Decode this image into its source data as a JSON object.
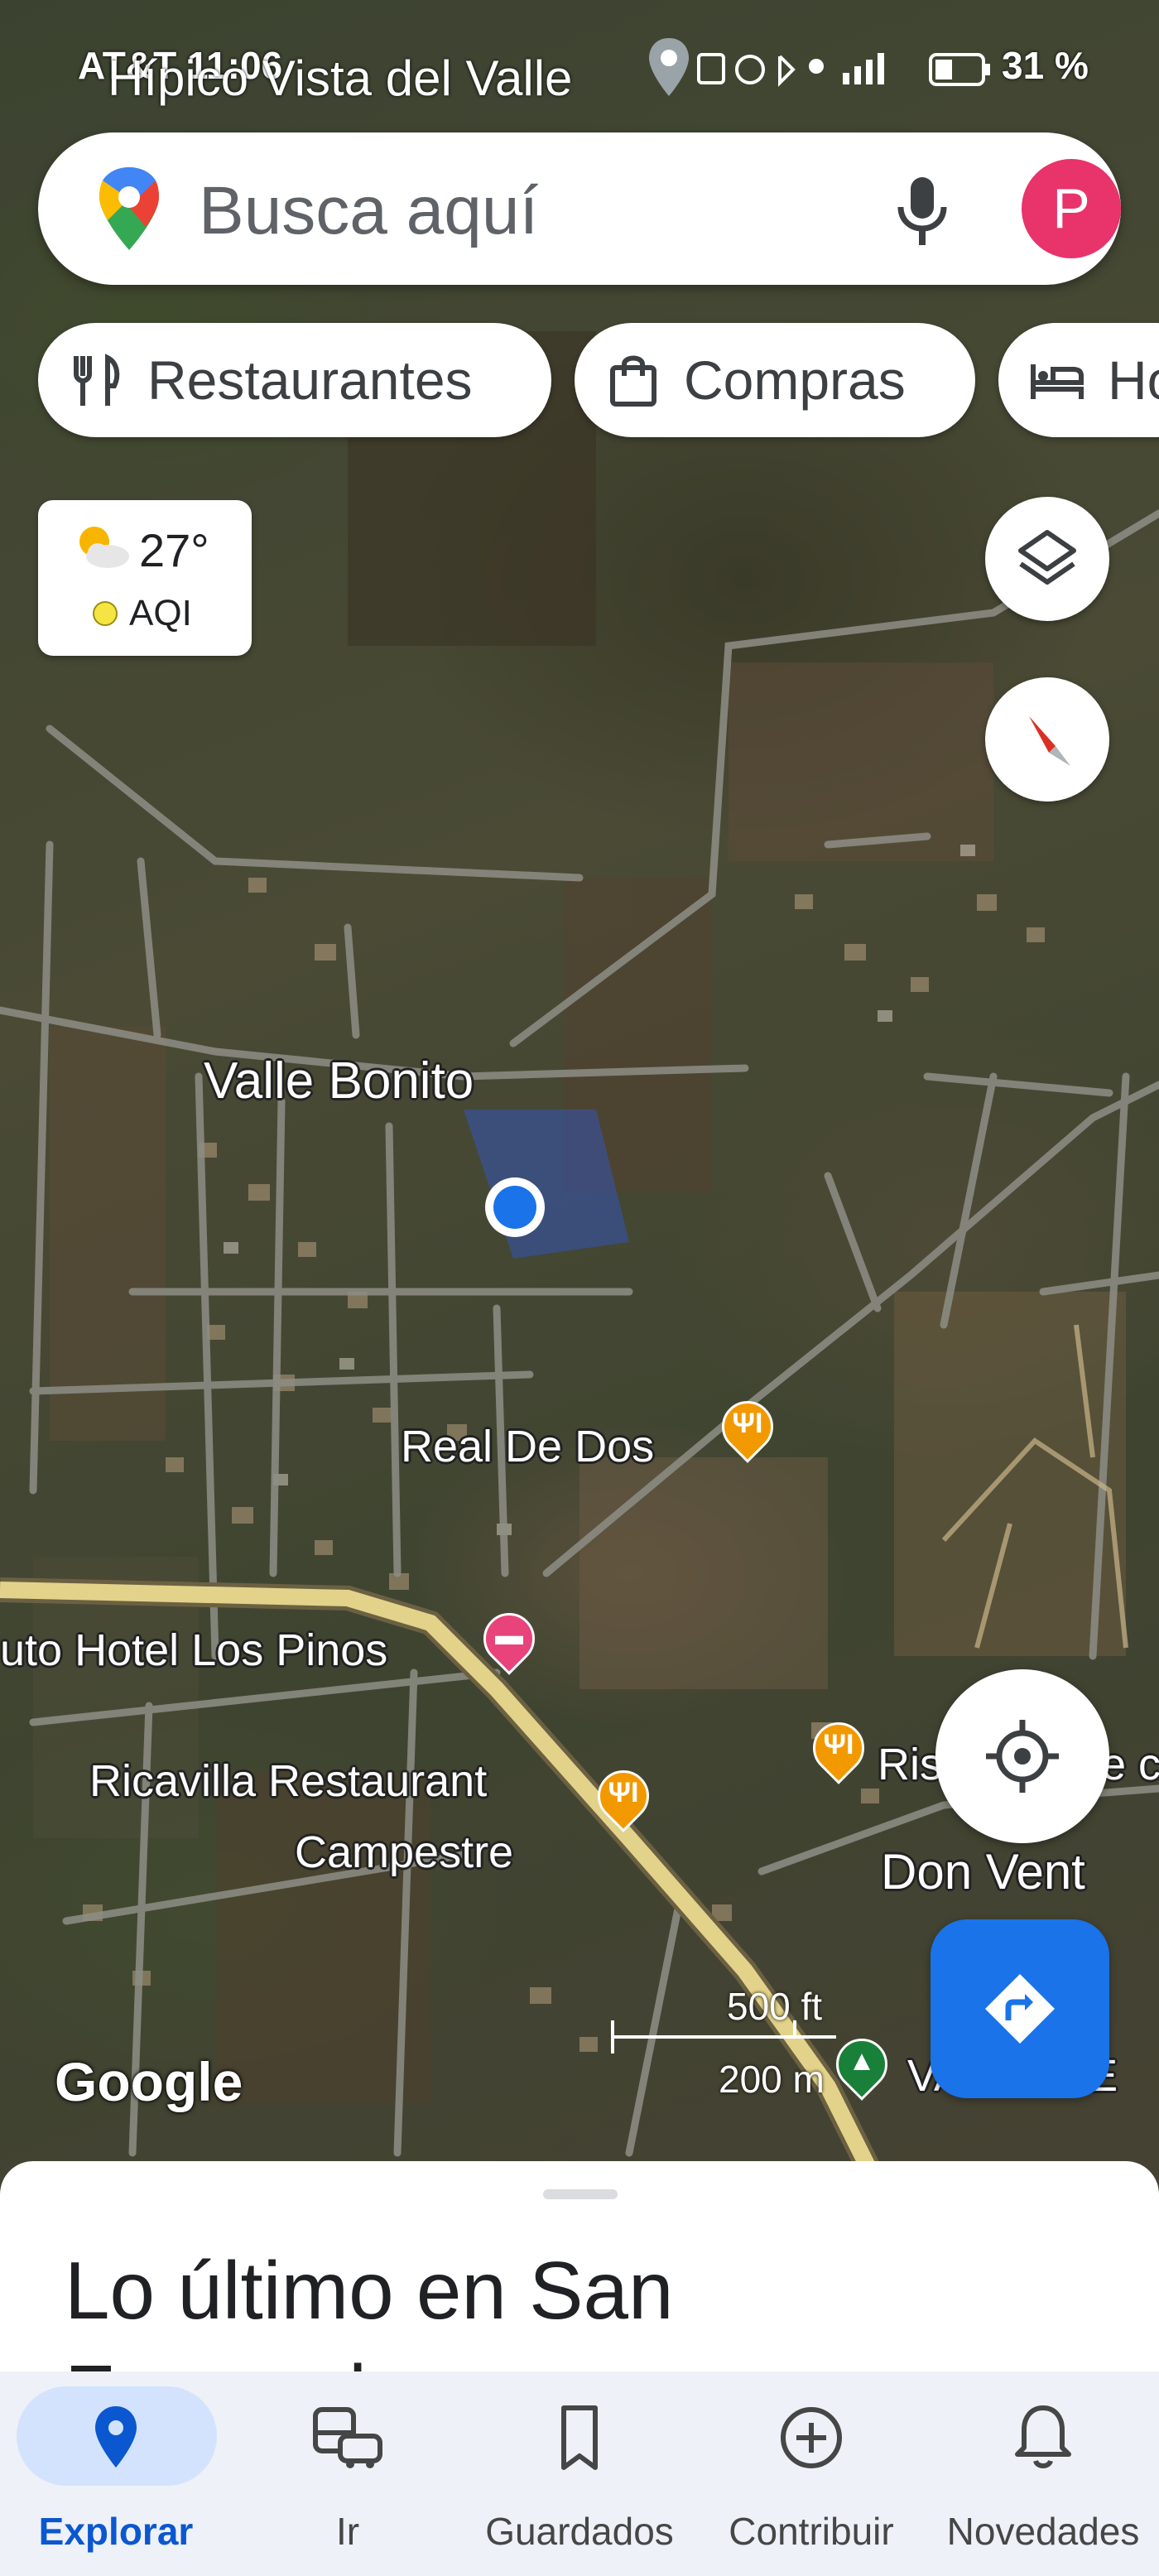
{
  "status_bar": {
    "left_text": "AT&T 11:06",
    "overlay_place": "Hípico Vista del Valle",
    "battery": "31 %"
  },
  "search": {
    "placeholder": "Busca aquí",
    "avatar_initial": "P"
  },
  "chips": [
    {
      "label": "Restaurantes",
      "icon": "fork-knife-icon"
    },
    {
      "label": "Compras",
      "icon": "shopping-bag-icon"
    },
    {
      "label": "Ho",
      "icon": "bed-icon"
    }
  ],
  "weather": {
    "temperature": "27°",
    "aqi_label": "AQI"
  },
  "map": {
    "labels": {
      "valle_bonito": "Valle Bonito",
      "real_de_dos": "Real De Dos",
      "hotel_los_pinos": "uto Hotel Los Pinos",
      "ricavilla_line1": "Ricavilla Restaurant",
      "ricavilla_line2": "Campestre",
      "ris": "Ris",
      "ris_tail": "e c",
      "don_vent": "Don Vent",
      "valle_de": "VALLE DE"
    },
    "google_logo": "Google",
    "scale_imperial": "500 ft",
    "scale_metric": "200 m"
  },
  "sheet": {
    "title_line1": "Lo último en San",
    "title_line2": "Fernando"
  },
  "nav": [
    {
      "label": "Explorar",
      "icon": "explore-pin-icon",
      "active": true
    },
    {
      "label": "Ir",
      "icon": "commute-icon",
      "active": false
    },
    {
      "label": "Guardados",
      "icon": "bookmark-icon",
      "active": false
    },
    {
      "label": "Contribuir",
      "icon": "add-circle-icon",
      "active": false
    },
    {
      "label": "Novedades",
      "icon": "bell-icon",
      "active": false
    }
  ],
  "colors": {
    "accent": "#1a73e8",
    "avatar": "#e8336b",
    "restaurant_pin": "#f29900",
    "hotel_pin": "#e8437a",
    "park_pin": "#188038"
  }
}
